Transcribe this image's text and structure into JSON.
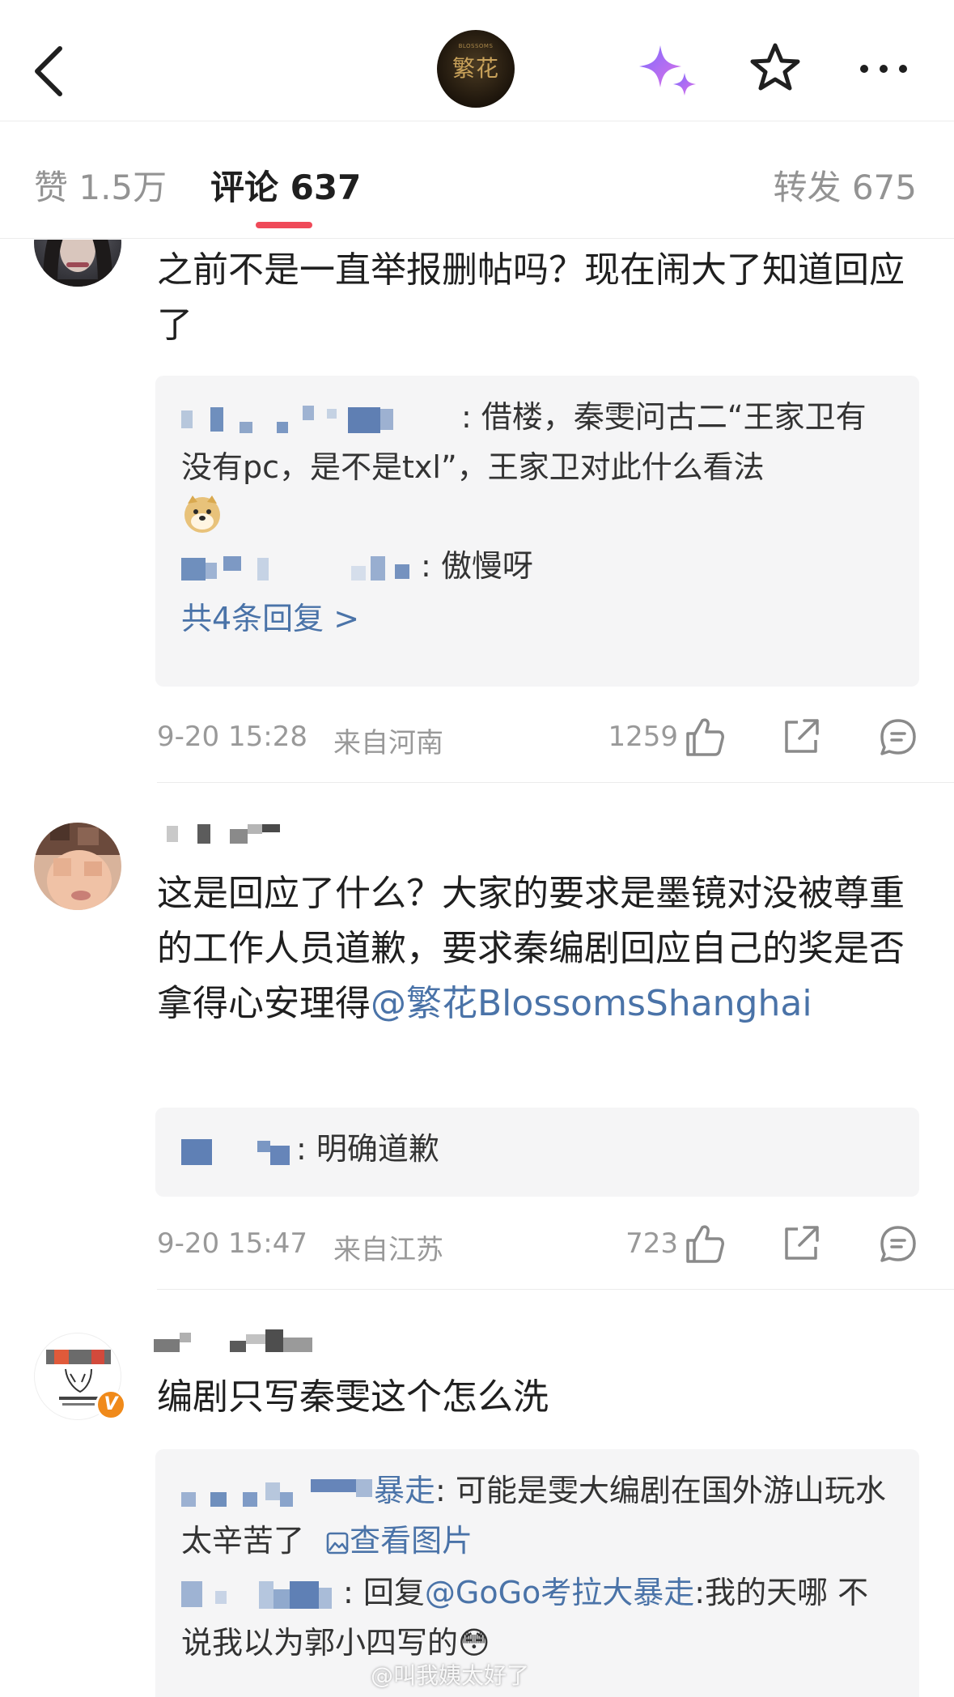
{
  "topbar": {
    "logo_text": "繁花",
    "logo_small_text": "BLOSSOMS"
  },
  "tabs": {
    "like": "赞 1.5万",
    "comment": "评论 637",
    "repost": "转发 675"
  },
  "comments": [
    {
      "text": "之前不是一直举报删帖吗？现在闹大了知道回应了",
      "replies": [
        {
          "text": ": 借楼，秦雯问古二“王家卫有没有pc，是不是txl”，王家卫对此什么看法"
        },
        {
          "text": ": 傲慢呀"
        }
      ],
      "more_replies": "共4条回复 >",
      "time": "9-20 15:28",
      "location": "来自河南",
      "likes": "1259"
    },
    {
      "text_before_mention": "这是回应了什么？大家的要求是墨镜对没被尊重的工作人员道歉，要求秦编剧回应自己的奖是否拿得心安理得",
      "mention": "@繁花BlossomsShanghai",
      "replies": [
        {
          "text": ": 明确道歉"
        }
      ],
      "time": "9-20 15:47",
      "location": "来自江苏",
      "likes": "723"
    },
    {
      "text": "编剧只写秦雯这个怎么洗",
      "replies": [
        {
          "name_tail": "暴走",
          "text": ": 可能是雯大编剧在国外游山玩水太辛苦了",
          "image_link": "查看图片"
        },
        {
          "text_before": ": 回复",
          "mention": "@GoGo考拉大暴走",
          "text_after": ":我的天哪 不说我以为郭小四写的😳"
        }
      ]
    }
  ],
  "badges": {
    "verified": "V"
  },
  "watermark": "@叫我姨太好了",
  "colors": {
    "accent": "#ef4a59",
    "link": "#4a73a8",
    "meta": "#999999",
    "reply_bg": "#f5f5f6"
  }
}
